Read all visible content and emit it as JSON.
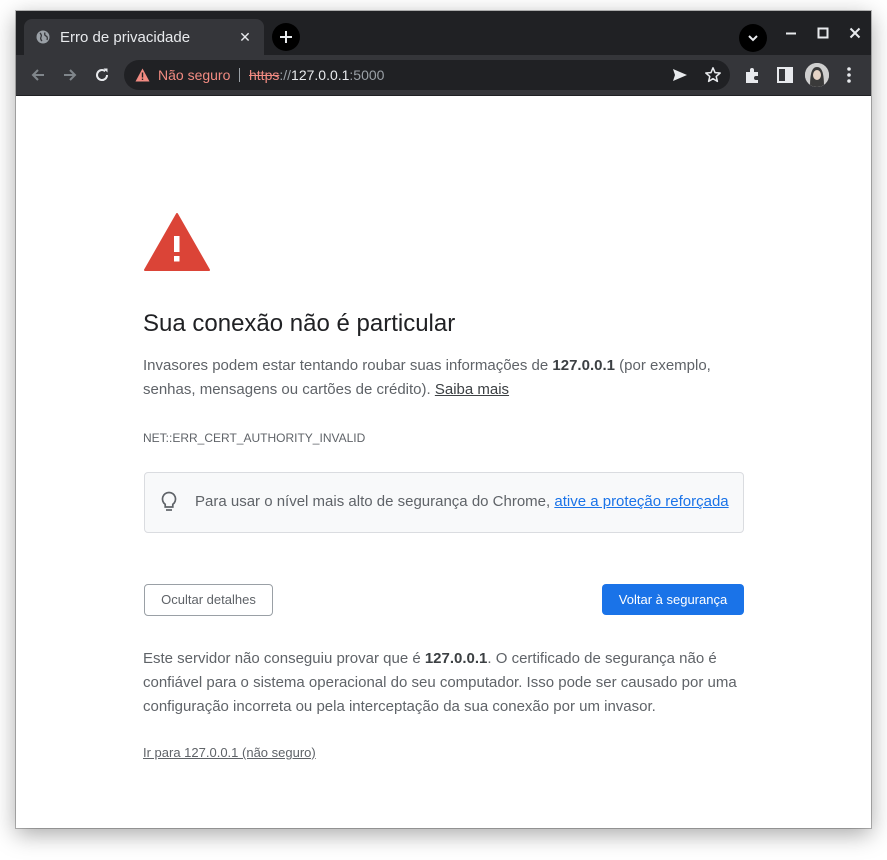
{
  "tab": {
    "title": "Erro de privacidade",
    "close_label": "✕"
  },
  "omnibox": {
    "security_label": "Não seguro",
    "url_scheme": "https",
    "url_sep": "://",
    "url_host": "127.0.0.1",
    "url_port": ":5000"
  },
  "interstitial": {
    "heading": "Sua conexão não é particular",
    "explanation_before": "Invasores podem estar tentando roubar suas informações de ",
    "explanation_host": "127.0.0.1",
    "explanation_after": " (por exemplo, senhas, mensagens ou cartões de crédito). ",
    "learn_more_link": "Saiba mais",
    "error_code": "NET::ERR_CERT_AUTHORITY_INVALID",
    "enhanced_protection_text": "Para usar o nível mais alto de segurança do Chrome, ",
    "enhanced_protection_link": "ative a proteção reforçada",
    "details_button": "Ocultar detalhes",
    "back_button": "Voltar à segurança",
    "details_before": "Este servidor não conseguiu provar que é ",
    "details_host": "127.0.0.1",
    "details_after": ". O certificado de segurança não é confiável para o sistema operacional do seu computador. Isso pode ser causado por uma configuração incorreta ou pela interceptação da sua conexão por um invasor.",
    "proceed_link": "Ir para 127.0.0.1 (não seguro)"
  },
  "colors": {
    "accent_blue": "#1a73e8",
    "warning_red": "#db4437",
    "not_secure_red": "#f28b82",
    "titlebar": "#202124",
    "toolbar": "#35363a"
  }
}
